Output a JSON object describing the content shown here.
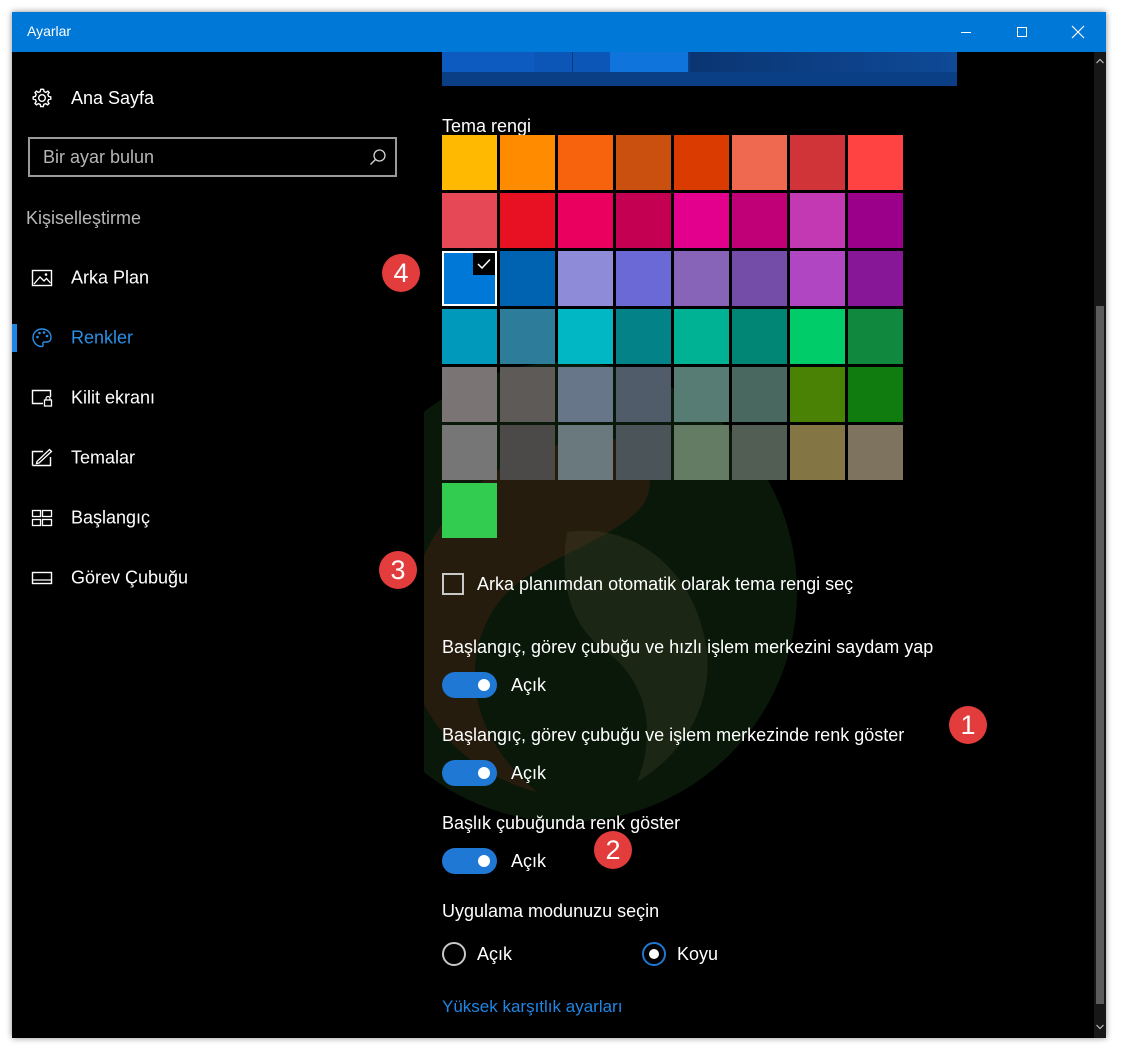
{
  "window": {
    "title": "Ayarlar"
  },
  "sidebar": {
    "home_label": "Ana Sayfa",
    "search_placeholder": "Bir ayar bulun",
    "section": "Kişiselleştirme",
    "items": [
      {
        "label": "Arka Plan",
        "icon": "picture-icon"
      },
      {
        "label": "Renkler",
        "icon": "palette-icon",
        "active": true
      },
      {
        "label": "Kilit ekranı",
        "icon": "lock-screen-icon"
      },
      {
        "label": "Temalar",
        "icon": "themes-icon"
      },
      {
        "label": "Başlangıç",
        "icon": "start-icon"
      },
      {
        "label": "Görev Çubuğu",
        "icon": "taskbar-icon"
      }
    ]
  },
  "content": {
    "theme_color_label": "Tema rengi",
    "selected_color": "#0078d7",
    "swatch_rows": [
      [
        "#ffb900",
        "#ff8c00",
        "#f7630c",
        "#ca5010",
        "#da3b01",
        "#ef6950",
        "#d13438",
        "#ff4343"
      ],
      [
        "#e74856",
        "#e81123",
        "#ea005e",
        "#c30052",
        "#e3008c",
        "#bf0077",
        "#c239b3",
        "#9a0089"
      ],
      [
        "#0078d7",
        "#0063b1",
        "#8e8cd8",
        "#6b69d6",
        "#8764b8",
        "#744da9",
        "#b146c2",
        "#881798"
      ],
      [
        "#0099bc",
        "#2d7d9a",
        "#00b7c3",
        "#038387",
        "#00b294",
        "#018574",
        "#00cc6a",
        "#10893e"
      ],
      [
        "#7a7574",
        "#5d5a58",
        "#68768a",
        "#515c6b",
        "#567c73",
        "#486860",
        "#498205",
        "#107c10"
      ],
      [
        "#767676",
        "#4c4a48",
        "#69797e",
        "#4a5459",
        "#647c64",
        "#525e54",
        "#847545",
        "#7e735f"
      ],
      [
        "#32cd50"
      ]
    ],
    "auto_color_label": "Arka planımdan otomatik olarak tema rengi seç",
    "auto_color_checked": false,
    "transparency_label": "Başlangıç, görev çubuğu ve hızlı işlem merkezini saydam yap",
    "transparency_state": "Açık",
    "show_color_label": "Başlangıç, görev çubuğu ve işlem merkezinde renk göster",
    "show_color_state": "Açık",
    "titlebar_color_label": "Başlık çubuğunda renk göster",
    "titlebar_color_state": "Açık",
    "app_mode_label": "Uygulama modunuzu seçin",
    "mode_light": "Açık",
    "mode_dark": "Koyu",
    "selected_mode": "Koyu",
    "high_contrast_link": "Yüksek karşıtlık ayarları"
  },
  "annotations": {
    "one": "1",
    "two": "2",
    "three": "3",
    "four": "4"
  },
  "colors": {
    "accent": "#0078d7",
    "badge": "#e23c3c",
    "link": "#1f86e5"
  }
}
